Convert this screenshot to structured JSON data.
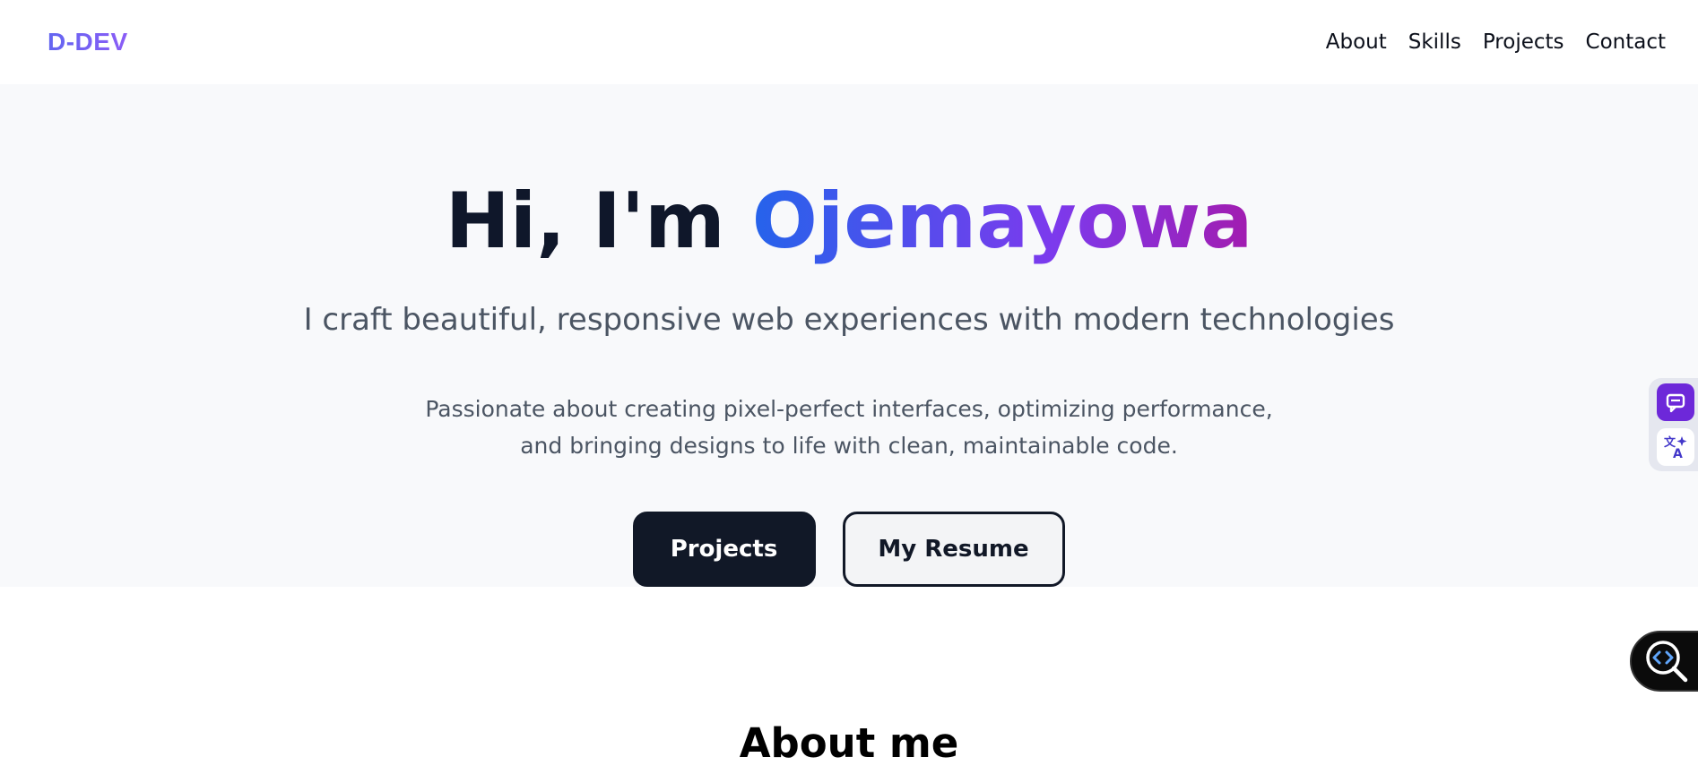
{
  "nav": {
    "logo": "D-DEV",
    "links": [
      "About",
      "Skills",
      "Projects",
      "Contact"
    ]
  },
  "hero": {
    "greeting": "Hi, I'm ",
    "name": "Ojemayowa",
    "subtitle": "I craft beautiful, responsive web experiences with modern technologies",
    "description_line1": "Passionate about creating pixel-perfect interfaces, optimizing performance,",
    "description_line2": "and bringing designs to life with clean, maintainable code.",
    "primary_button": "Projects",
    "secondary_button": "My Resume"
  },
  "about": {
    "heading": "About me"
  },
  "extension_toolbar": {
    "icons": [
      "chat-bubble-icon",
      "translate-icon"
    ],
    "floating_icon": "code-search-icon"
  },
  "colors": {
    "logo_gradient": [
      "#6366f1",
      "#8b5cf6"
    ],
    "name_gradient": [
      "#2563eb",
      "#7c3aed",
      "#a21caf"
    ],
    "primary_button_bg": "#111827",
    "hero_bg": "#f8f9fb",
    "toolbar_accent": "#6d28d9"
  }
}
